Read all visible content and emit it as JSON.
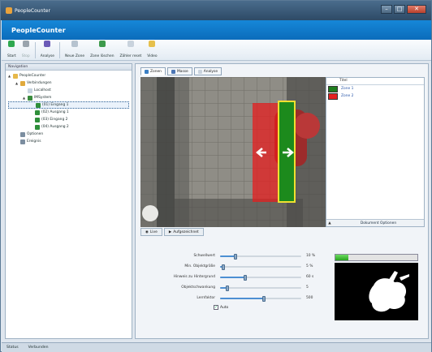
{
  "window": {
    "title": "PeopleCounter",
    "banner": "PeopleCounter"
  },
  "toolbar": {
    "items": [
      {
        "label": "Start",
        "icon": "start-icon",
        "color": "#2fa84f"
      },
      {
        "label": "Stop",
        "icon": "stop-icon",
        "color": "#9aa4ad",
        "disabled": true
      },
      {
        "label": "Analyse",
        "icon": "analyse-icon",
        "color": "#6b5bb7"
      },
      {
        "label": "Neue Zone",
        "icon": "new-zone-icon",
        "color": "#b6c3cf"
      },
      {
        "label": "Zone löschen",
        "icon": "delete-zone-icon",
        "color": "#3d9a4c"
      },
      {
        "label": "Zähler reset",
        "icon": "counter-reset-icon",
        "color": "#c9d3dd"
      },
      {
        "label": "Video",
        "icon": "video-icon",
        "color": "#e6c04c"
      }
    ]
  },
  "navigation": {
    "header": "Navigation",
    "tree": [
      {
        "label": "PeopleCounter",
        "level": 0,
        "expander": "▲",
        "icon_color": "#e6b84a"
      },
      {
        "label": "Verbindungen",
        "level": 1,
        "expander": "▲",
        "icon_color": "#e0a93c"
      },
      {
        "label": "Localhost",
        "level": 2,
        "expander": "",
        "icon_color": "#c7d4e0"
      },
      {
        "label": "IMSystem",
        "level": 2,
        "expander": "▲",
        "icon_color": "#3a8d3e"
      },
      {
        "label": "(01) Eingang 1",
        "level": 3,
        "expander": "",
        "icon_color": "#2f8f3a",
        "selected": true
      },
      {
        "label": "(02) Ausgang 1",
        "level": 3,
        "expander": "",
        "icon_color": "#2f8f3a"
      },
      {
        "label": "(03) Eingang 2",
        "level": 3,
        "expander": "",
        "icon_color": "#2f8f3a"
      },
      {
        "label": "(04) Ausgang 2",
        "level": 3,
        "expander": "",
        "icon_color": "#2f8f3a"
      },
      {
        "label": "Optionen",
        "level": 1,
        "expander": "",
        "icon_color": "#7c8ea0"
      },
      {
        "label": "Ereignis",
        "level": 1,
        "expander": "",
        "icon_color": "#7c8ea0"
      }
    ]
  },
  "tabs": [
    {
      "label": "Zonen",
      "color": "#3b7fc4",
      "active": true
    },
    {
      "label": "Masse",
      "color": "#4c76b5"
    },
    {
      "label": "Analyse",
      "color": "#c9d3dd"
    }
  ],
  "zones": {
    "header": "Titel",
    "items": [
      {
        "label": "Zone 1",
        "color": "#1d7d1d"
      },
      {
        "label": "Zone 2",
        "color": "#e22020"
      }
    ],
    "footer_icon": "▲",
    "footer_label": "Dokument Optionen"
  },
  "view_tabs": [
    {
      "label": "Live",
      "icon": "live-icon"
    },
    {
      "label": "Aufgezeichnet",
      "icon": "play-icon"
    }
  ],
  "sliders": [
    {
      "label": "Schwellwert",
      "value_text": "10 %",
      "level": 0.19
    },
    {
      "label": "Min. Objektgröße",
      "value_text": "5 %",
      "level": 0.04
    },
    {
      "label": "Hinweis zu Hintergrund",
      "value_text": "60 s",
      "level": 0.31
    },
    {
      "label": "Objektschwankung",
      "value_text": "5",
      "level": 0.09
    },
    {
      "label": "Lernfaktor",
      "value_text": "500",
      "level": 0.54
    }
  ],
  "auto_checkbox": {
    "label": "Auto",
    "checked": true
  },
  "progress": {
    "level": 0.16
  },
  "statusbar": {
    "status": "Status",
    "connected": "Verbunden"
  }
}
